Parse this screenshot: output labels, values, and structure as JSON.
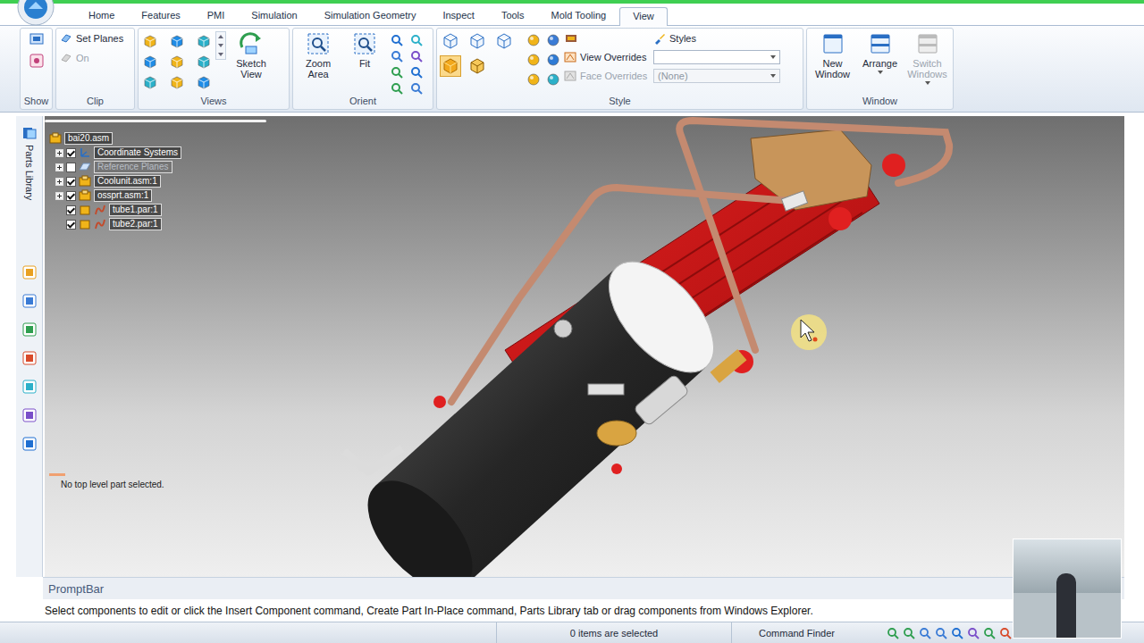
{
  "app_tabs": [
    {
      "label": "Home",
      "selected": false
    },
    {
      "label": "Features",
      "selected": false
    },
    {
      "label": "PMI",
      "selected": false
    },
    {
      "label": "Simulation",
      "selected": false
    },
    {
      "label": "Simulation Geometry",
      "selected": false
    },
    {
      "label": "Inspect",
      "selected": false
    },
    {
      "label": "Tools",
      "selected": false
    },
    {
      "label": "Mold Tooling",
      "selected": false
    },
    {
      "label": "View",
      "selected": true
    }
  ],
  "ribbon": {
    "show": {
      "label": "Show"
    },
    "clip": {
      "label": "Clip",
      "buttons": [
        {
          "label": "Set Planes",
          "disabled": false
        },
        {
          "label": "On",
          "disabled": true
        }
      ]
    },
    "views": {
      "label": "Views",
      "sketch_view": {
        "label": "Sketch View",
        "disabled": false
      }
    },
    "orient": {
      "label": "Orient",
      "buttons": [
        {
          "label": "Zoom Area",
          "disabled": false
        },
        {
          "label": "Fit",
          "disabled": false
        }
      ]
    },
    "style": {
      "label": "Style",
      "overrides": [
        {
          "label": "View Overrides",
          "disabled": false
        },
        {
          "label": "Face Overrides",
          "disabled": true
        }
      ],
      "styles": {
        "label": "Styles"
      },
      "dropdowns": [
        {
          "value": "",
          "disabled": false
        },
        {
          "value": "(None)",
          "disabled": true
        }
      ]
    },
    "window": {
      "label": "Window",
      "buttons": [
        {
          "label": "New Window",
          "disabled": false,
          "has_menu": false
        },
        {
          "label": "Arrange",
          "disabled": false,
          "has_menu": true
        },
        {
          "label": "Switch Windows",
          "disabled": true,
          "has_menu": true
        }
      ]
    }
  },
  "left_rail": {
    "label": "Parts Library"
  },
  "tree": {
    "root": {
      "label": "bai20.asm"
    },
    "items": [
      {
        "label": "Coordinate Systems",
        "kind": "coordinate-systems",
        "checked": true,
        "expandable": true
      },
      {
        "label": "Reference Planes",
        "kind": "reference-planes",
        "checked": false,
        "expandable": true
      },
      {
        "label": "Coolunit.asm:1",
        "kind": "assembly",
        "checked": true,
        "expandable": true
      },
      {
        "label": "ossprt.asm:1",
        "kind": "assembly",
        "checked": true,
        "expandable": true
      },
      {
        "label": "tube1.par:1",
        "kind": "part",
        "checked": true,
        "expandable": false
      },
      {
        "label": "tube2.par:1",
        "kind": "part",
        "checked": true,
        "expandable": false
      }
    ]
  },
  "viewport": {
    "message": "No top level part selected."
  },
  "prompt_bar": {
    "title": "PromptBar",
    "text": "Select components to edit or click the Insert Component command, Create Part In-Place command, Parts Library tab or drag components from Windows Explorer."
  },
  "status_bar": {
    "selection": "0 items are selected",
    "command_finder": {
      "label": "Command Finder",
      "value": ""
    }
  }
}
